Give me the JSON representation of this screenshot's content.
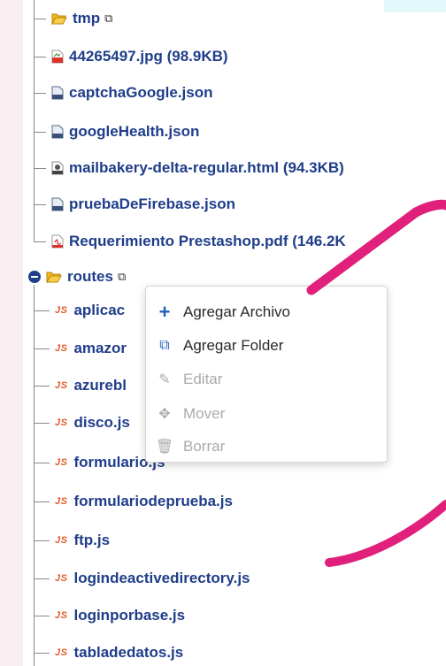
{
  "tree": {
    "tmp_folder": {
      "label": "tmp"
    },
    "tmp_files": [
      {
        "name": "44265497.jpg (98.9KB)",
        "type": "jpg"
      },
      {
        "name": "captchaGoogle.json",
        "type": "json"
      },
      {
        "name": "googleHealth.json",
        "type": "json"
      },
      {
        "name": "mailbakery-delta-regular.html (94.3KB)",
        "type": "html"
      },
      {
        "name": "pruebaDeFirebase.json",
        "type": "json"
      },
      {
        "name": "Requerimiento Prestashop.pdf (146.2K",
        "type": "pdf"
      }
    ],
    "routes_folder": {
      "label": "routes"
    },
    "routes_files": [
      "aplicac",
      "amazor",
      "azurebl",
      "disco.js",
      "formulario.js",
      "formulariodeprueba.js",
      "ftp.js",
      "logindeactivedirectory.js",
      "loginporbase.js",
      "tabladedatos.js"
    ],
    "js_badge": "JS"
  },
  "context_menu": {
    "items": [
      {
        "label": "Agregar Archivo",
        "icon": "plus-icon",
        "enabled": true
      },
      {
        "label": "Agregar Folder",
        "icon": "copy-folder-icon",
        "enabled": true
      },
      {
        "label": "Editar",
        "icon": "edit-icon",
        "enabled": false
      },
      {
        "label": "Mover",
        "icon": "move-icon",
        "enabled": false
      },
      {
        "label": "Borrar",
        "icon": "trash-icon",
        "enabled": false
      }
    ]
  },
  "colors": {
    "file_text": "#1f3d8a",
    "folder_icon": "#f2b81d",
    "annotation_stroke": "#e0207a",
    "plus_icon": "#1f5fbf"
  }
}
